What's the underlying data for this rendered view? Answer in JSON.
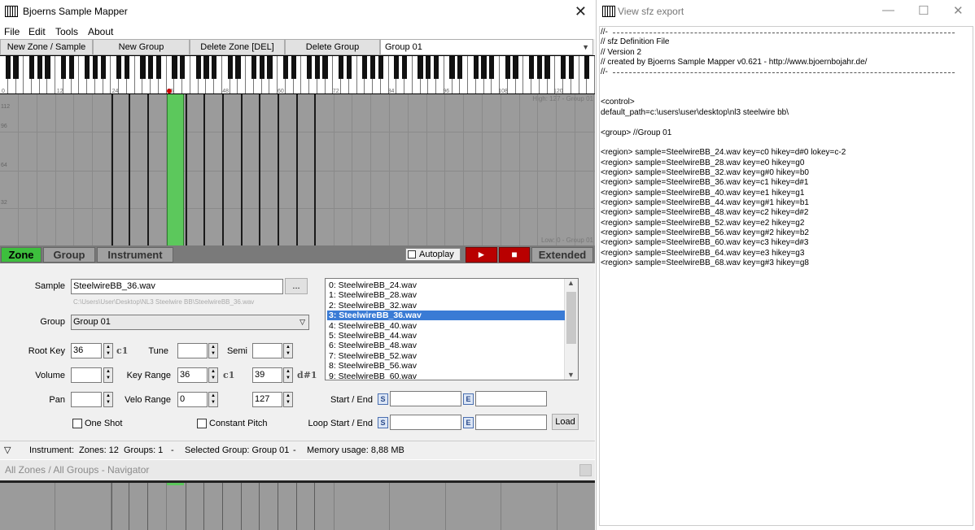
{
  "main": {
    "title": "Bjoerns Sample Mapper",
    "menu": [
      "File",
      "Edit",
      "Tools",
      "About"
    ],
    "toolbar": {
      "new_zone": "New Zone / Sample",
      "new_group": "New Group",
      "delete_zone": "Delete Zone [DEL]",
      "delete_group": "Delete Group",
      "group_select": "Group 01"
    },
    "keyboard_ticks": [
      "0",
      "12",
      "24",
      "36",
      "48",
      "60",
      "72",
      "84",
      "96",
      "108",
      "120"
    ],
    "grid": {
      "vlabels": [
        "112",
        "96",
        "64",
        "32"
      ],
      "high_label": "High: 127 - Group 01",
      "low_label": "Low: 0 - Group 01"
    },
    "tabs": {
      "zone": "Zone",
      "group": "Group",
      "instrument": "Instrument",
      "autoplay": "Autoplay",
      "extended": "Extended",
      "play": "►",
      "stop": "■"
    },
    "form": {
      "sample_label": "Sample",
      "sample_value": "SteelwireBB_36.wav",
      "browse": "...",
      "sample_path": "C:\\Users\\User\\Desktop\\NL3 Steelwire BB\\SteelwireBB_36.wav",
      "group_label": "Group",
      "group_value": "Group 01",
      "rootkey_label": "Root Key",
      "rootkey_value": "36",
      "rootkey_note": "c1",
      "tune_label": "Tune",
      "tune_value": "",
      "semi_label": "Semi",
      "semi_value": "",
      "volume_label": "Volume",
      "volume_value": "",
      "keyrange_label": "Key Range",
      "keyrange_low": "36",
      "keyrange_low_note": "c1",
      "keyrange_high": "39",
      "keyrange_high_note": "d#1",
      "pan_label": "Pan",
      "pan_value": "",
      "velo_label": "Velo Range",
      "velo_low": "0",
      "velo_high": "127",
      "one_shot": "One Shot",
      "constant_pitch": "Constant Pitch",
      "start_end_label": "Start / End",
      "loop_label": "Loop Start / End",
      "s_marker": "S",
      "e_marker": "E",
      "load": "Load"
    },
    "samples": [
      "0: SteelwireBB_24.wav",
      "1: SteelwireBB_28.wav",
      "2: SteelwireBB_32.wav",
      "3: SteelwireBB_36.wav",
      "4: SteelwireBB_40.wav",
      "5: SteelwireBB_44.wav",
      "6: SteelwireBB_48.wav",
      "7: SteelwireBB_52.wav",
      "8: SteelwireBB_56.wav",
      "9: SteelwireBB_60.wav"
    ],
    "selected_sample_index": 3,
    "status": {
      "toggle": "▽",
      "instrument": "Instrument:",
      "zones": "Zones: 12",
      "groups": "Groups: 1",
      "sep": "-",
      "selected_group": "Selected Group: Group 01",
      "memory": "Memory usage: 8,88 MB"
    },
    "navigator_title": "All Zones / All Groups - Navigator"
  },
  "sfz": {
    "title": "View sfz export",
    "minimize": "—",
    "maximize": "☐",
    "close": "✕",
    "lines": [
      "//-",
      "// sfz Definition File",
      "// Version 2",
      "// created by Bjoerns Sample Mapper v0.621  -  http://www.bjoernbojahr.de/",
      "//-",
      "",
      "",
      "<control>",
      "default_path=c:\\users\\user\\desktop\\nl3 steelwire bb\\",
      "",
      "<group> //Group 01",
      "",
      "<region> sample=SteelwireBB_24.wav key=c0 hikey=d#0 lokey=c-2",
      "<region> sample=SteelwireBB_28.wav key=e0 hikey=g0",
      "<region> sample=SteelwireBB_32.wav key=g#0 hikey=b0",
      "<region> sample=SteelwireBB_36.wav key=c1 hikey=d#1",
      "<region> sample=SteelwireBB_40.wav key=e1 hikey=g1",
      "<region> sample=SteelwireBB_44.wav key=g#1 hikey=b1",
      "<region> sample=SteelwireBB_48.wav key=c2 hikey=d#2",
      "<region> sample=SteelwireBB_52.wav key=e2 hikey=g2",
      "<region> sample=SteelwireBB_56.wav key=g#2 hikey=b2",
      "<region> sample=SteelwireBB_60.wav key=c3 hikey=d#3",
      "<region> sample=SteelwireBB_64.wav key=e3 hikey=g3",
      "<region> sample=SteelwireBB_68.wav key=g#3 hikey=g8"
    ]
  },
  "colors": {
    "zone_green": "#5cc85c",
    "selected_blue": "#3a7bd5",
    "transport_red": "#b90000"
  }
}
